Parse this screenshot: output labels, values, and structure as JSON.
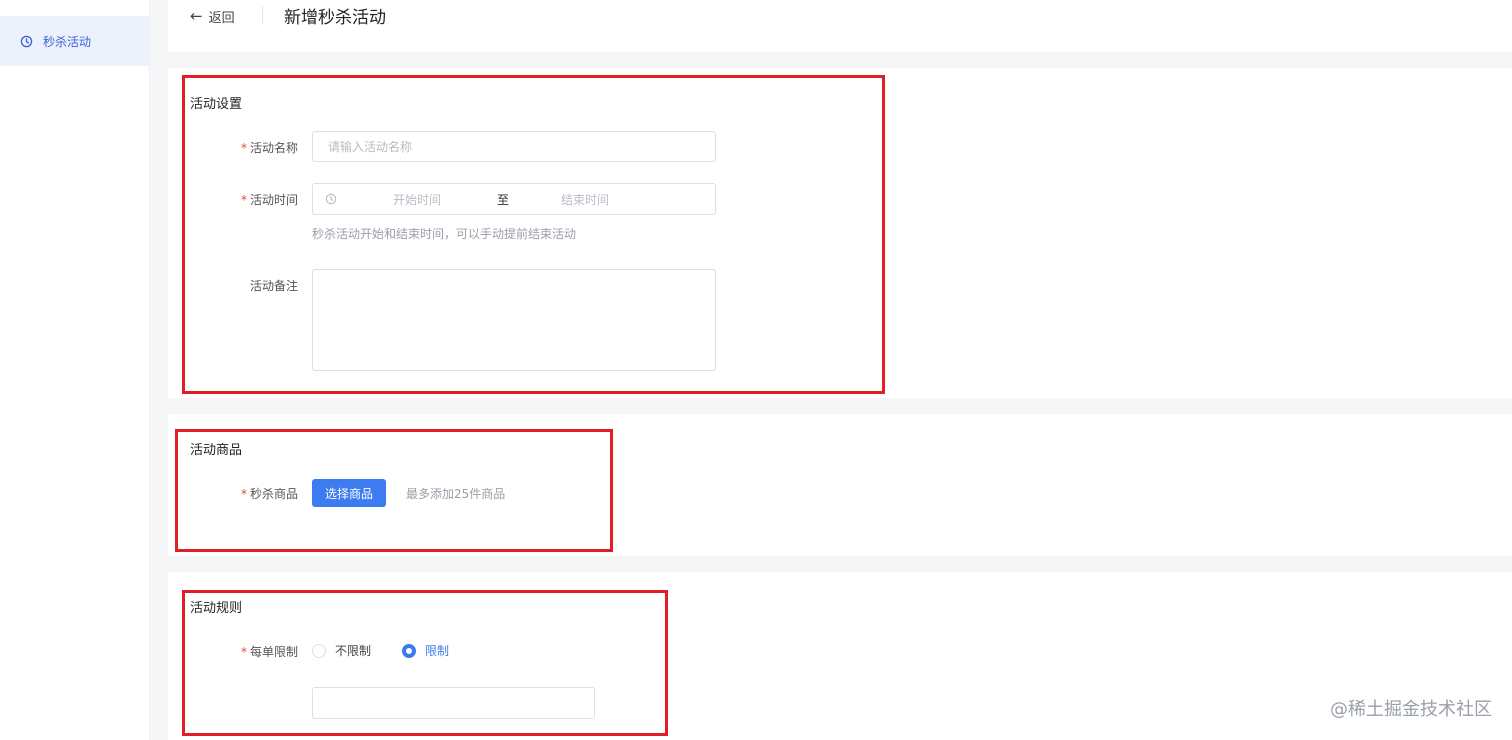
{
  "sidebar": {
    "item_label": "秒杀活动",
    "item_icon": "clock-refresh-icon"
  },
  "header": {
    "back_label": "返回",
    "title": "新增秒杀活动"
  },
  "settings": {
    "title": "活动设置",
    "name_label": "活动名称",
    "name_placeholder": "请输入活动名称",
    "time_label": "活动时间",
    "start_placeholder": "开始时间",
    "separator": "至",
    "end_placeholder": "结束时间",
    "time_hint": "秒杀活动开始和结束时间，可以手动提前结束活动",
    "note_label": "活动备注"
  },
  "goods": {
    "title": "活动商品",
    "goods_label": "秒杀商品",
    "select_button": "选择商品",
    "hint": "最多添加25件商品"
  },
  "rules": {
    "title": "活动规则",
    "limit_label": "每单限制",
    "option_unlimited": "不限制",
    "option_limited": "限制",
    "selected": "限制"
  },
  "watermark": "@稀土掘金技术社区",
  "colors": {
    "primary": "#3d7bf0",
    "required": "#e8473f",
    "highlight_box": "#e01e26"
  }
}
